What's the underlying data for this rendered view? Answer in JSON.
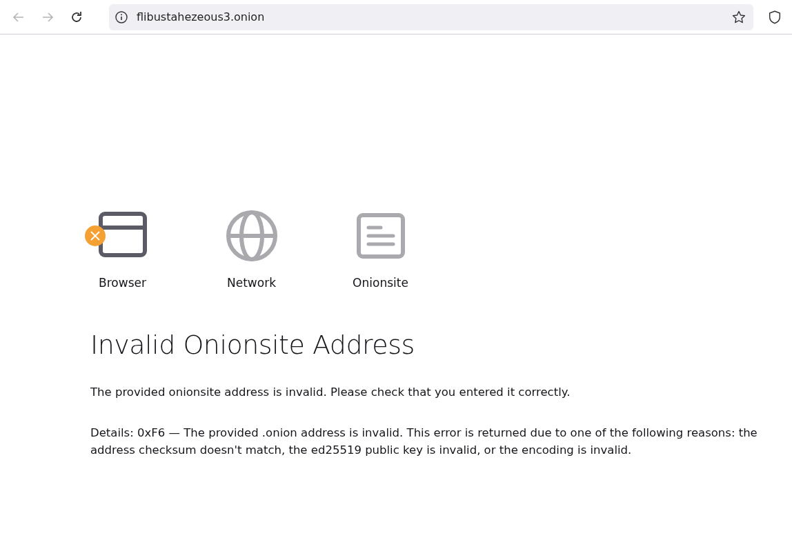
{
  "toolbar": {
    "back": {
      "disabled": true
    },
    "forward": {
      "disabled": true
    },
    "url": "flibustahezeous3.onion"
  },
  "steps": [
    {
      "kind": "browser",
      "label": "Browser",
      "error": true
    },
    {
      "kind": "network",
      "label": "Network",
      "error": false
    },
    {
      "kind": "onionsite",
      "label": "Onionsite",
      "error": false
    }
  ],
  "title": "Invalid Onionsite Address",
  "message": "The provided onionsite address is invalid. Please check that you entered it correctly.",
  "details": "Details: 0xF6 — The provided .onion address is invalid. This error is returned due to one of the following reasons: the address checksum doesn't match, the ed25519 public key is invalid, or the encoding is invalid."
}
